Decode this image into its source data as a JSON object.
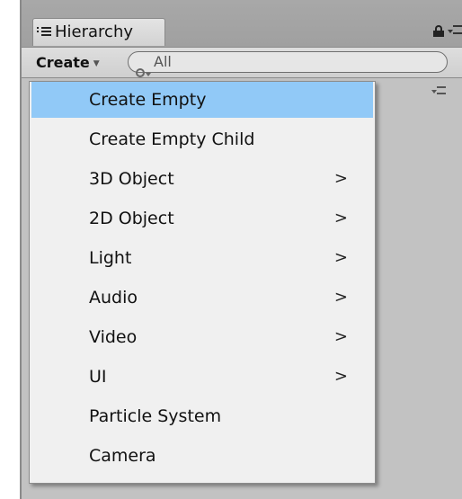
{
  "panel": {
    "tab_title": "Hierarchy"
  },
  "toolbar": {
    "create_label": "Create",
    "search_value": "All"
  },
  "menu": {
    "items": [
      {
        "label": "Create Empty",
        "submenu": false,
        "selected": true
      },
      {
        "label": "Create Empty Child",
        "submenu": false,
        "selected": false
      },
      {
        "label": "3D Object",
        "submenu": true,
        "selected": false
      },
      {
        "label": "2D Object",
        "submenu": true,
        "selected": false
      },
      {
        "label": "Light",
        "submenu": true,
        "selected": false
      },
      {
        "label": "Audio",
        "submenu": true,
        "selected": false
      },
      {
        "label": "Video",
        "submenu": true,
        "selected": false
      },
      {
        "label": "UI",
        "submenu": true,
        "selected": false
      },
      {
        "label": "Particle System",
        "submenu": false,
        "selected": false
      },
      {
        "label": "Camera",
        "submenu": false,
        "selected": false
      }
    ],
    "submenu_arrow": ">"
  },
  "colors": {
    "highlight": "#91c9f7",
    "panel_bg": "#c2c2c2",
    "menu_bg": "#f0f0f0"
  }
}
